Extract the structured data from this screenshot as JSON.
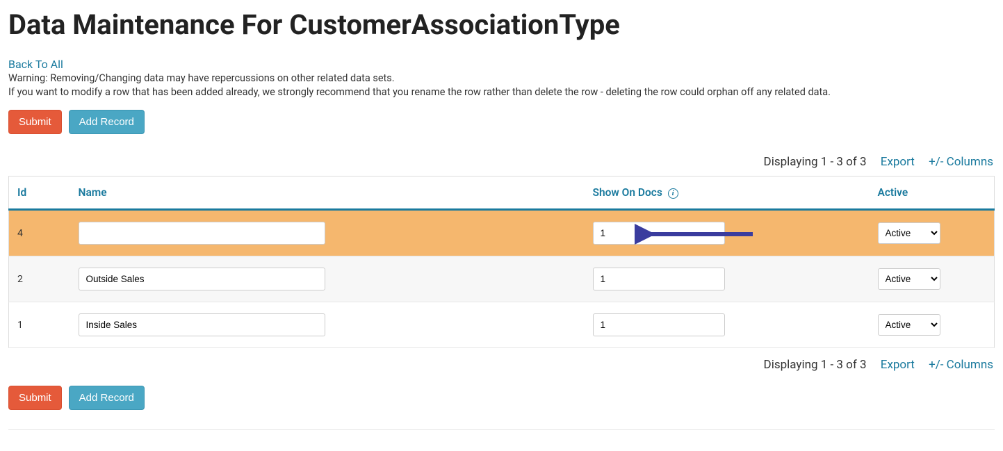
{
  "page_title": "Data Maintenance For CustomerAssociationType",
  "back_link": "Back To All",
  "warning_line1": "Warning: Removing/Changing data may have repercussions on other related data sets.",
  "warning_line2": "If you want to modify a row that has been added already, we strongly recommend that you rename the row rather than delete the row - deleting the row could orphan off any related data.",
  "buttons": {
    "submit": "Submit",
    "add_record": "Add Record"
  },
  "pager": {
    "display_text": "Displaying 1 - 3 of 3",
    "export": "Export",
    "columns": "+/- Columns"
  },
  "columns": {
    "id": "Id",
    "name": "Name",
    "show_on_docs": "Show On Docs",
    "active": "Active"
  },
  "rows": [
    {
      "id": "4",
      "name": "",
      "show": "1",
      "active": "Active",
      "highlight": true
    },
    {
      "id": "2",
      "name": "Outside Sales",
      "show": "1",
      "active": "Active",
      "highlight": false,
      "alt": true
    },
    {
      "id": "1",
      "name": "Inside Sales",
      "show": "1",
      "active": "Active",
      "highlight": false
    }
  ],
  "select_options": [
    "Active"
  ]
}
